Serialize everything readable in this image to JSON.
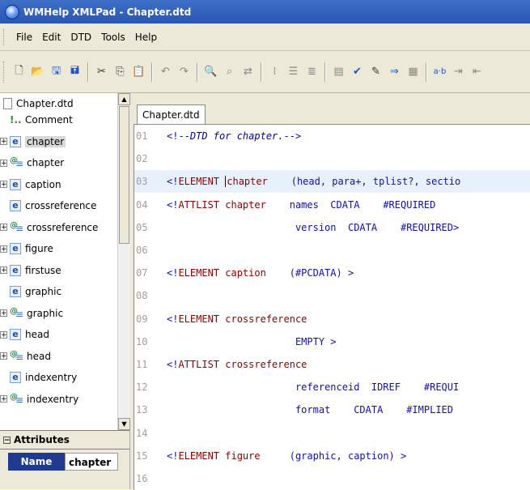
{
  "window": {
    "title": "WMHelp XMLPad - Chapter.dtd"
  },
  "menu": [
    "File",
    "Edit",
    "DTD",
    "Tools",
    "Help"
  ],
  "tree": {
    "root": "Chapter.dtd",
    "items": [
      {
        "label": "Comment",
        "type": "comment",
        "expandable": false
      },
      {
        "label": "chapter",
        "type": "element",
        "expandable": true,
        "selected": true
      },
      {
        "label": "chapter",
        "type": "attlist",
        "expandable": true
      },
      {
        "label": "caption",
        "type": "element",
        "expandable": true
      },
      {
        "label": "crossreference",
        "type": "element",
        "expandable": false
      },
      {
        "label": "crossreference",
        "type": "attlist",
        "expandable": true
      },
      {
        "label": "figure",
        "type": "element",
        "expandable": true
      },
      {
        "label": "firstuse",
        "type": "element",
        "expandable": true
      },
      {
        "label": "graphic",
        "type": "element",
        "expandable": false
      },
      {
        "label": "graphic",
        "type": "attlist",
        "expandable": true
      },
      {
        "label": "head",
        "type": "element",
        "expandable": true
      },
      {
        "label": "head",
        "type": "attlist",
        "expandable": true
      },
      {
        "label": "indexentry",
        "type": "element",
        "expandable": false
      },
      {
        "label": "indexentry",
        "type": "attlist",
        "expandable": true
      }
    ]
  },
  "attributes": {
    "header": "Attributes",
    "name_label": "Name",
    "name_value": "chapter"
  },
  "editor": {
    "tab": "Chapter.dtd",
    "lines": [
      {
        "n": "01",
        "parts": [
          [
            "blue",
            "<!--"
          ],
          [
            "cmt",
            "DTD for chapter."
          ],
          [
            "blue",
            "-->"
          ]
        ]
      },
      {
        "n": "02",
        "parts": []
      },
      {
        "n": "03",
        "parts": [
          [
            "blue",
            "<!"
          ],
          [
            "kw",
            "ELEMENT "
          ],
          [
            "caret",
            ""
          ],
          [
            "el",
            "chapter"
          ],
          [
            "blue",
            "    (head, para+, tplist?, sectio"
          ]
        ],
        "highlight": true
      },
      {
        "n": "04",
        "parts": [
          [
            "blue",
            "<!"
          ],
          [
            "kw",
            "ATTLIST "
          ],
          [
            "el",
            "chapter"
          ],
          [
            "blue",
            "    names  CDATA    #REQUIRED"
          ]
        ]
      },
      {
        "n": "05",
        "parts": [
          [
            "blue",
            "                      version  CDATA    #REQUIRED>"
          ]
        ]
      },
      {
        "n": "06",
        "parts": []
      },
      {
        "n": "07",
        "parts": [
          [
            "blue",
            "<!"
          ],
          [
            "kw",
            "ELEMENT "
          ],
          [
            "el",
            "caption"
          ],
          [
            "blue",
            "    (#PCDATA) >"
          ]
        ]
      },
      {
        "n": "08",
        "parts": []
      },
      {
        "n": "09",
        "parts": [
          [
            "blue",
            "<!"
          ],
          [
            "kw",
            "ELEMENT "
          ],
          [
            "el",
            "crossreference"
          ]
        ]
      },
      {
        "n": "10",
        "parts": [
          [
            "blue",
            "                      EMPTY >"
          ]
        ]
      },
      {
        "n": "11",
        "parts": [
          [
            "blue",
            "<!"
          ],
          [
            "kw",
            "ATTLIST "
          ],
          [
            "el",
            "crossreference"
          ]
        ]
      },
      {
        "n": "12",
        "parts": [
          [
            "blue",
            "                      referenceid  IDREF    #REQUI"
          ]
        ]
      },
      {
        "n": "13",
        "parts": [
          [
            "blue",
            "                      format    CDATA    #IMPLIED"
          ]
        ]
      },
      {
        "n": "14",
        "parts": []
      },
      {
        "n": "15",
        "parts": [
          [
            "blue",
            "<!"
          ],
          [
            "kw",
            "ELEMENT "
          ],
          [
            "el",
            "figure"
          ],
          [
            "blue",
            "     (graphic, caption) >"
          ]
        ]
      },
      {
        "n": "16",
        "parts": []
      }
    ]
  }
}
